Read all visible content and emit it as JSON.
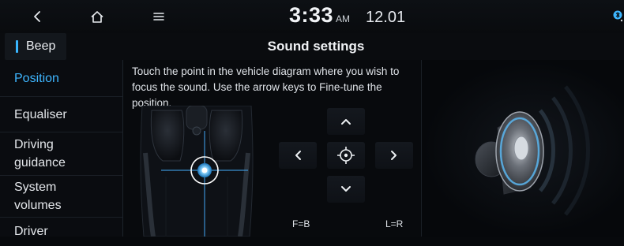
{
  "status_bar": {
    "time": "3:33",
    "ampm": "AM",
    "date": "12.01"
  },
  "header": {
    "back_tab_label": "Beep",
    "title": "Sound settings"
  },
  "sidebar": {
    "items": [
      {
        "label": "Position",
        "active": true
      },
      {
        "label": "Equaliser",
        "active": false
      },
      {
        "label": "Driving guidance",
        "active": false
      },
      {
        "label": "System volumes",
        "active": false
      },
      {
        "label": "Driver",
        "active": false
      }
    ]
  },
  "main": {
    "instruction": "Touch the point in the vehicle diagram where you wish to focus the sound. Use the arrow keys to Fine-tune the position.",
    "fb_label": "F=B",
    "lr_label": "L=R"
  },
  "colors": {
    "accent": "#3eb6ff",
    "background": "#07090c"
  },
  "icons": {
    "back": "chevron-left-icon",
    "home": "home-icon",
    "menu": "menu-icon",
    "bluetooth": "bluetooth-icon",
    "up": "chevron-up-icon",
    "down": "chevron-down-icon",
    "left": "chevron-left-icon",
    "right": "chevron-right-icon",
    "center": "target-icon",
    "speaker": "speaker-icon"
  }
}
